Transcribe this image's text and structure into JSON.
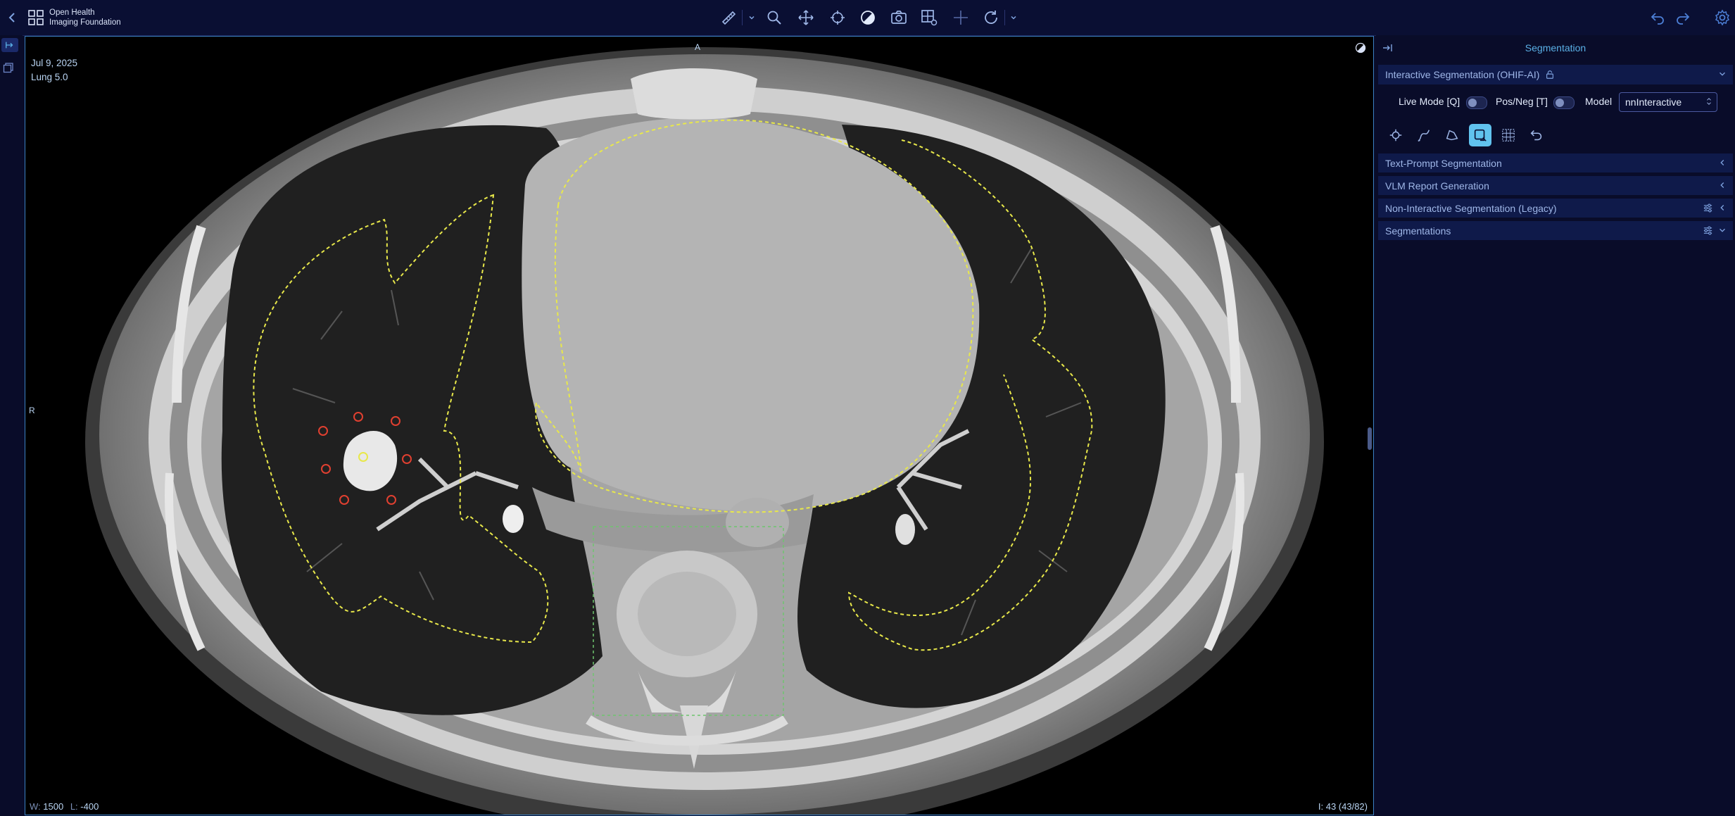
{
  "header": {
    "logo_line1": "Open Health",
    "logo_line2": "Imaging Foundation"
  },
  "toolbar": {
    "icons": [
      "measure-icon",
      "zoom-icon",
      "pan-icon",
      "crosshair-icon",
      "window-level-icon",
      "capture-icon",
      "layout-icon",
      "crosshair-plus-icon",
      "rotate-icon"
    ],
    "right_icons": [
      "undo-icon",
      "redo-icon",
      "settings-icon"
    ]
  },
  "viewport": {
    "date": "Jul 9, 2025",
    "series": "Lung 5.0",
    "orientation_top": "A",
    "orientation_left": "R",
    "window_label": "W:",
    "window_value": "1500",
    "level_label": "L:",
    "level_value": "-400",
    "instance": "I: 43 (43/82)"
  },
  "panel": {
    "title": "Segmentation",
    "interactive": {
      "label": "Interactive Segmentation (OHIF-AI)",
      "live_mode": "Live Mode [Q]",
      "posneg": "Pos/Neg [T]",
      "model_label": "Model",
      "model_value": "nnInteractive"
    },
    "rows": [
      "Text-Prompt Segmentation",
      "VLM Report Generation",
      "Non-Interactive Segmentation (Legacy)",
      "Segmentations"
    ]
  },
  "colors": {
    "accent": "#5ab0e6",
    "active_tool": "#61c3ee",
    "contour_yellow": "#e8e84a",
    "point_red": "#e04030",
    "box_green": "#6ec46e"
  }
}
